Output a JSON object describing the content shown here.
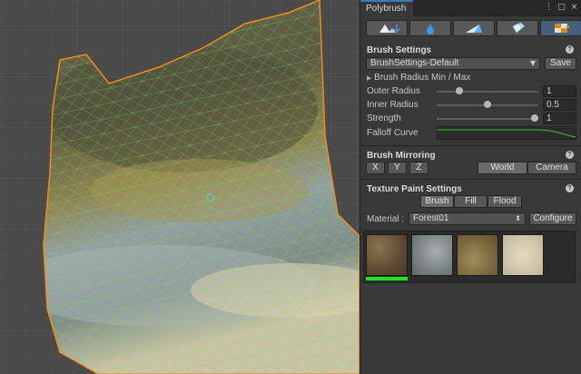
{
  "window": {
    "tab_title": "Polybrush"
  },
  "tab_icons": {
    "menu": "⋮",
    "maximize": "□",
    "close": "×"
  },
  "modes": [
    {
      "icon": "raise-lower-icon",
      "active": false
    },
    {
      "icon": "smooth-icon",
      "active": false
    },
    {
      "icon": "sculpt-icon",
      "active": false
    },
    {
      "icon": "paint-prefab-icon",
      "active": false
    },
    {
      "icon": "texture-paint-icon",
      "active": true
    }
  ],
  "brush_settings": {
    "title": "Brush Settings",
    "preset": "BrushSettings-Default",
    "save_label": "Save",
    "radius_minmax_label": "Brush Radius Min / Max",
    "outer_radius": {
      "label": "Outer Radius",
      "value": "1",
      "fraction": 0.2
    },
    "inner_radius": {
      "label": "Inner Radius",
      "value": "0.5",
      "fraction": 0.5
    },
    "strength": {
      "label": "Strength",
      "value": "1",
      "fraction": 1.0
    },
    "falloff_label": "Falloff Curve"
  },
  "brush_mirroring": {
    "title": "Brush Mirroring",
    "axes": [
      "X",
      "Y",
      "Z"
    ],
    "space_options": [
      "World",
      "Camera"
    ],
    "selected_space": "World"
  },
  "texture_paint": {
    "title": "Texture Paint Settings",
    "modes": [
      "Brush",
      "Fill",
      "Flood"
    ],
    "selected_mode": "Brush",
    "material_label": "Material :",
    "material_value": "Forest01",
    "configure_label": "Configure",
    "textures": [
      "dirt-texture",
      "rock-texture",
      "moss-texture",
      "sand-texture"
    ],
    "selected_texture_index": 0
  },
  "help_glyph": "?",
  "arrow_glyph": "▶",
  "dropdown_glyph": "▼",
  "stepper_glyph": "⬍",
  "colors": {
    "accent": "#3a79bb",
    "selected": "#1ee41e",
    "mesh_outline": "#f08c1e",
    "wire": "#7ddb5a"
  }
}
